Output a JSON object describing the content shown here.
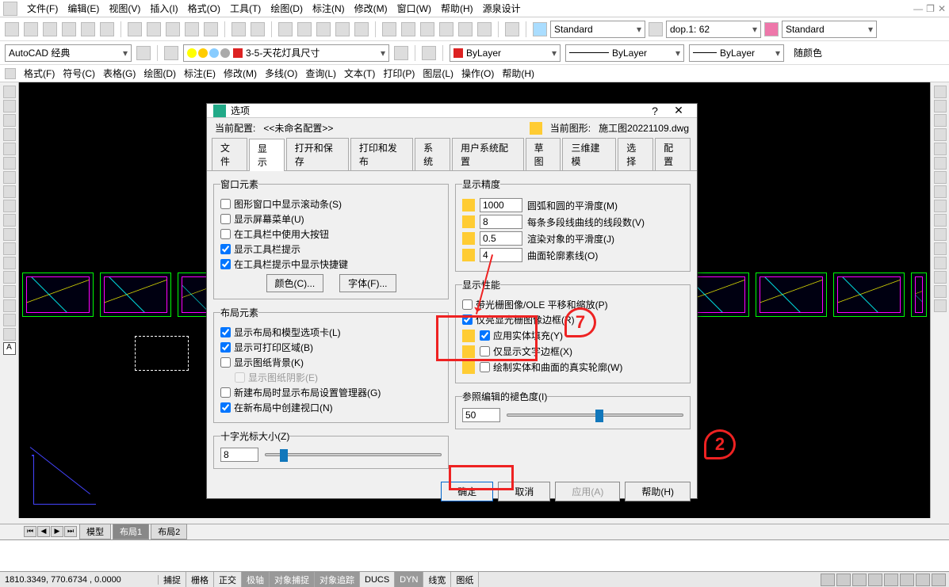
{
  "menubar": [
    "文件(F)",
    "编辑(E)",
    "视图(V)",
    "插入(I)",
    "格式(O)",
    "工具(T)",
    "绘图(D)",
    "标注(N)",
    "修改(M)",
    "窗口(W)",
    "帮助(H)",
    "源泉设计"
  ],
  "secondary_menu": [
    "格式(F)",
    "符号(C)",
    "表格(G)",
    "绘图(D)",
    "标注(E)",
    "修改(M)",
    "多线(O)",
    "查询(L)",
    "文本(T)",
    "打印(P)",
    "图层(L)",
    "操作(O)",
    "帮助(H)"
  ],
  "workspace": "AutoCAD 经典",
  "row1_styles": {
    "text1": "Standard",
    "dim": "dop.1: 62",
    "text2": "Standard"
  },
  "row2": {
    "layer_name": "3-5-天花灯具尺寸",
    "bylayer": "ByLayer",
    "bylayer2": "ByLayer",
    "bylayer3": "ByLayer",
    "bycolor": "随颜色"
  },
  "dialog": {
    "title": "选项",
    "profile_label": "当前配置:",
    "profile_value": "<<未命名配置>>",
    "drawing_label": "当前图形:",
    "drawing_value": "施工图20221109.dwg",
    "tabs": [
      "文件",
      "显示",
      "打开和保存",
      "打印和发布",
      "系统",
      "用户系统配置",
      "草图",
      "三维建模",
      "选择",
      "配置"
    ],
    "active_tab": 1,
    "window_group": {
      "legend": "窗口元素",
      "scroll": "图形窗口中显示滚动条(S)",
      "screenmenu": "显示屏幕菜单(U)",
      "largebtn": "在工具栏中使用大按钮",
      "tooltips": "显示工具栏提示",
      "shortcuts": "在工具栏提示中显示快捷键",
      "color_btn": "颜色(C)...",
      "font_btn": "字体(F)..."
    },
    "layout_group": {
      "legend": "布局元素",
      "item1": "显示布局和模型选项卡(L)",
      "item2": "显示可打印区域(B)",
      "item3": "显示图纸背景(K)",
      "item3a": "显示图纸阴影(E)",
      "item4": "新建布局时显示布局设置管理器(G)",
      "item5": "在新布局中创建视口(N)"
    },
    "crosshair": {
      "legend": "十字光标大小(Z)",
      "value": "8"
    },
    "precision": {
      "legend": "显示精度",
      "arc": {
        "val": "1000",
        "label": "圆弧和圆的平滑度(M)"
      },
      "seg": {
        "val": "8",
        "label": "每条多段线曲线的线段数(V)"
      },
      "render": {
        "val": "0.5",
        "label": "渲染对象的平滑度(J)"
      },
      "surf": {
        "val": "4",
        "label": "曲面轮廓素线(O)"
      }
    },
    "perf": {
      "legend": "显示性能",
      "p1": "带光栅图像/OLE 平移和缩放(P)",
      "p2": "仅亮显光栅图像边框(R)",
      "p3": "应用实体填充(Y)",
      "p4": "仅显示文字边框(X)",
      "p5": "绘制实体和曲面的真实轮廓(W)"
    },
    "xref": {
      "legend": "参照编辑的褪色度(I)",
      "value": "50"
    },
    "buttons": {
      "ok": "确定",
      "cancel": "取消",
      "apply": "应用(A)",
      "help": "帮助(H)"
    }
  },
  "tabs_bottom": [
    "模型",
    "布局1",
    "布局2"
  ],
  "status": {
    "coords": "1810.3349, 770.6734 , 0.0000",
    "buttons": [
      "捕捉",
      "栅格",
      "正交",
      "极轴",
      "对象捕捉",
      "对象追踪",
      "DUCS",
      "DYN",
      "线宽",
      "图纸"
    ]
  },
  "annotations": {
    "num1": "7",
    "num2": "2"
  }
}
